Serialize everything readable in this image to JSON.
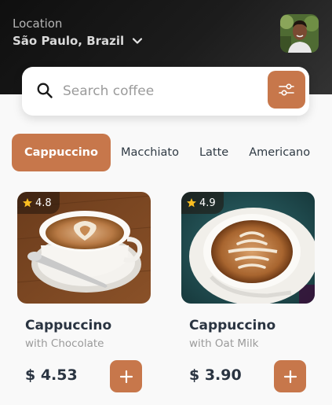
{
  "header": {
    "location_label": "Location",
    "location_value": "São Paulo, Brazil"
  },
  "search": {
    "placeholder": "Search coffee",
    "value": ""
  },
  "categories": [
    "Cappuccino",
    "Macchiato",
    "Latte",
    "Americano"
  ],
  "selected_category": "Cappuccino",
  "products": [
    {
      "rating": "4.8",
      "name": "Cappuccino",
      "subtitle": "with Chocolate",
      "price": "$ 4.53"
    },
    {
      "rating": "4.9",
      "name": "Cappuccino",
      "subtitle": "with Oat Milk",
      "price": "$ 3.90"
    }
  ],
  "colors": {
    "accent": "#c7774b",
    "header_dark": "#1a1a1a",
    "text_dark": "#2a3441",
    "text_muted": "#9a9a9a",
    "star": "#fbbe21"
  },
  "icons": {
    "location_dropdown": "chevron-down-icon",
    "search": "search-icon",
    "filter": "sliders-icon",
    "rating": "star-icon",
    "add": "plus-icon"
  }
}
